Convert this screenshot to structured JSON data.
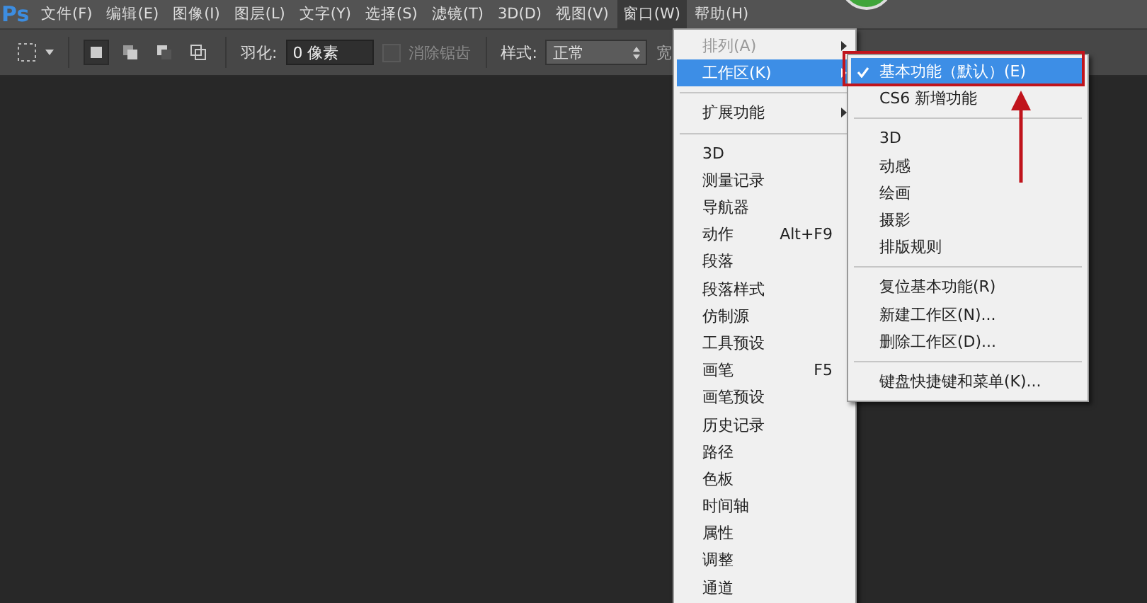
{
  "app_logo": "Ps",
  "menubar": [
    {
      "label": "文件(F)",
      "selected": false
    },
    {
      "label": "编辑(E)",
      "selected": false
    },
    {
      "label": "图像(I)",
      "selected": false
    },
    {
      "label": "图层(L)",
      "selected": false
    },
    {
      "label": "文字(Y)",
      "selected": false
    },
    {
      "label": "选择(S)",
      "selected": false
    },
    {
      "label": "滤镜(T)",
      "selected": false
    },
    {
      "label": "3D(D)",
      "selected": false
    },
    {
      "label": "视图(V)",
      "selected": false
    },
    {
      "label": "窗口(W)",
      "selected": true
    },
    {
      "label": "帮助(H)",
      "selected": false
    }
  ],
  "options_bar": {
    "modes": [
      {
        "selected": true
      },
      {
        "selected": false
      },
      {
        "selected": false
      },
      {
        "selected": false
      }
    ],
    "feather_label": "羽化:",
    "feather_value": "0 像素",
    "antialias": {
      "label": "消除锯齿",
      "checked": false,
      "disabled": true
    },
    "style_label": "样式:",
    "style_value": "正常",
    "width_label": "宽"
  },
  "window_menu": [
    {
      "kind": "item",
      "label": "排列(A)",
      "submenu": true,
      "disabled": true,
      "selected": false
    },
    {
      "kind": "item",
      "label": "工作区(K)",
      "submenu": true,
      "disabled": false,
      "selected": true
    },
    {
      "kind": "separator"
    },
    {
      "kind": "item",
      "label": "扩展功能",
      "submenu": true,
      "disabled": false,
      "selected": false
    },
    {
      "kind": "separator"
    },
    {
      "kind": "item",
      "label": "3D",
      "disabled": false,
      "selected": false
    },
    {
      "kind": "item",
      "label": "测量记录",
      "disabled": false,
      "selected": false
    },
    {
      "kind": "item",
      "label": "导航器",
      "disabled": false,
      "selected": false
    },
    {
      "kind": "item",
      "label": "动作",
      "shortcut": "Alt+F9",
      "disabled": false,
      "selected": false
    },
    {
      "kind": "item",
      "label": "段落",
      "disabled": false,
      "selected": false
    },
    {
      "kind": "item",
      "label": "段落样式",
      "disabled": false,
      "selected": false
    },
    {
      "kind": "item",
      "label": "仿制源",
      "disabled": false,
      "selected": false
    },
    {
      "kind": "item",
      "label": "工具预设",
      "disabled": false,
      "selected": false
    },
    {
      "kind": "item",
      "label": "画笔",
      "shortcut": "F5",
      "disabled": false,
      "selected": false
    },
    {
      "kind": "item",
      "label": "画笔预设",
      "disabled": false,
      "selected": false
    },
    {
      "kind": "item",
      "label": "历史记录",
      "disabled": false,
      "selected": false
    },
    {
      "kind": "item",
      "label": "路径",
      "disabled": false,
      "selected": false
    },
    {
      "kind": "item",
      "label": "色板",
      "disabled": false,
      "selected": false
    },
    {
      "kind": "item",
      "label": "时间轴",
      "disabled": false,
      "selected": false
    },
    {
      "kind": "item",
      "label": "属性",
      "disabled": false,
      "selected": false
    },
    {
      "kind": "item",
      "label": "调整",
      "disabled": false,
      "selected": false
    },
    {
      "kind": "item",
      "label": "通道",
      "disabled": false,
      "selected": false
    }
  ],
  "workspace_submenu": [
    {
      "kind": "item",
      "label": "基本功能（默认）(E)",
      "checked": true,
      "selected": true
    },
    {
      "kind": "item",
      "label": "CS6 新增功能",
      "checked": false,
      "selected": false
    },
    {
      "kind": "separator"
    },
    {
      "kind": "item",
      "label": "3D",
      "checked": false,
      "selected": false
    },
    {
      "kind": "item",
      "label": "动感",
      "checked": false,
      "selected": false
    },
    {
      "kind": "item",
      "label": "绘画",
      "checked": false,
      "selected": false
    },
    {
      "kind": "item",
      "label": "摄影",
      "checked": false,
      "selected": false
    },
    {
      "kind": "item",
      "label": "排版规则",
      "checked": false,
      "selected": false
    },
    {
      "kind": "separator"
    },
    {
      "kind": "item",
      "label": "复位基本功能(R)",
      "checked": false,
      "selected": false
    },
    {
      "kind": "item",
      "label": "新建工作区(N)...",
      "checked": false,
      "selected": false
    },
    {
      "kind": "item",
      "label": "删除工作区(D)...",
      "checked": false,
      "selected": false
    },
    {
      "kind": "separator"
    },
    {
      "kind": "item",
      "label": "键盘快捷键和菜单(K)...",
      "checked": false,
      "selected": false
    }
  ]
}
